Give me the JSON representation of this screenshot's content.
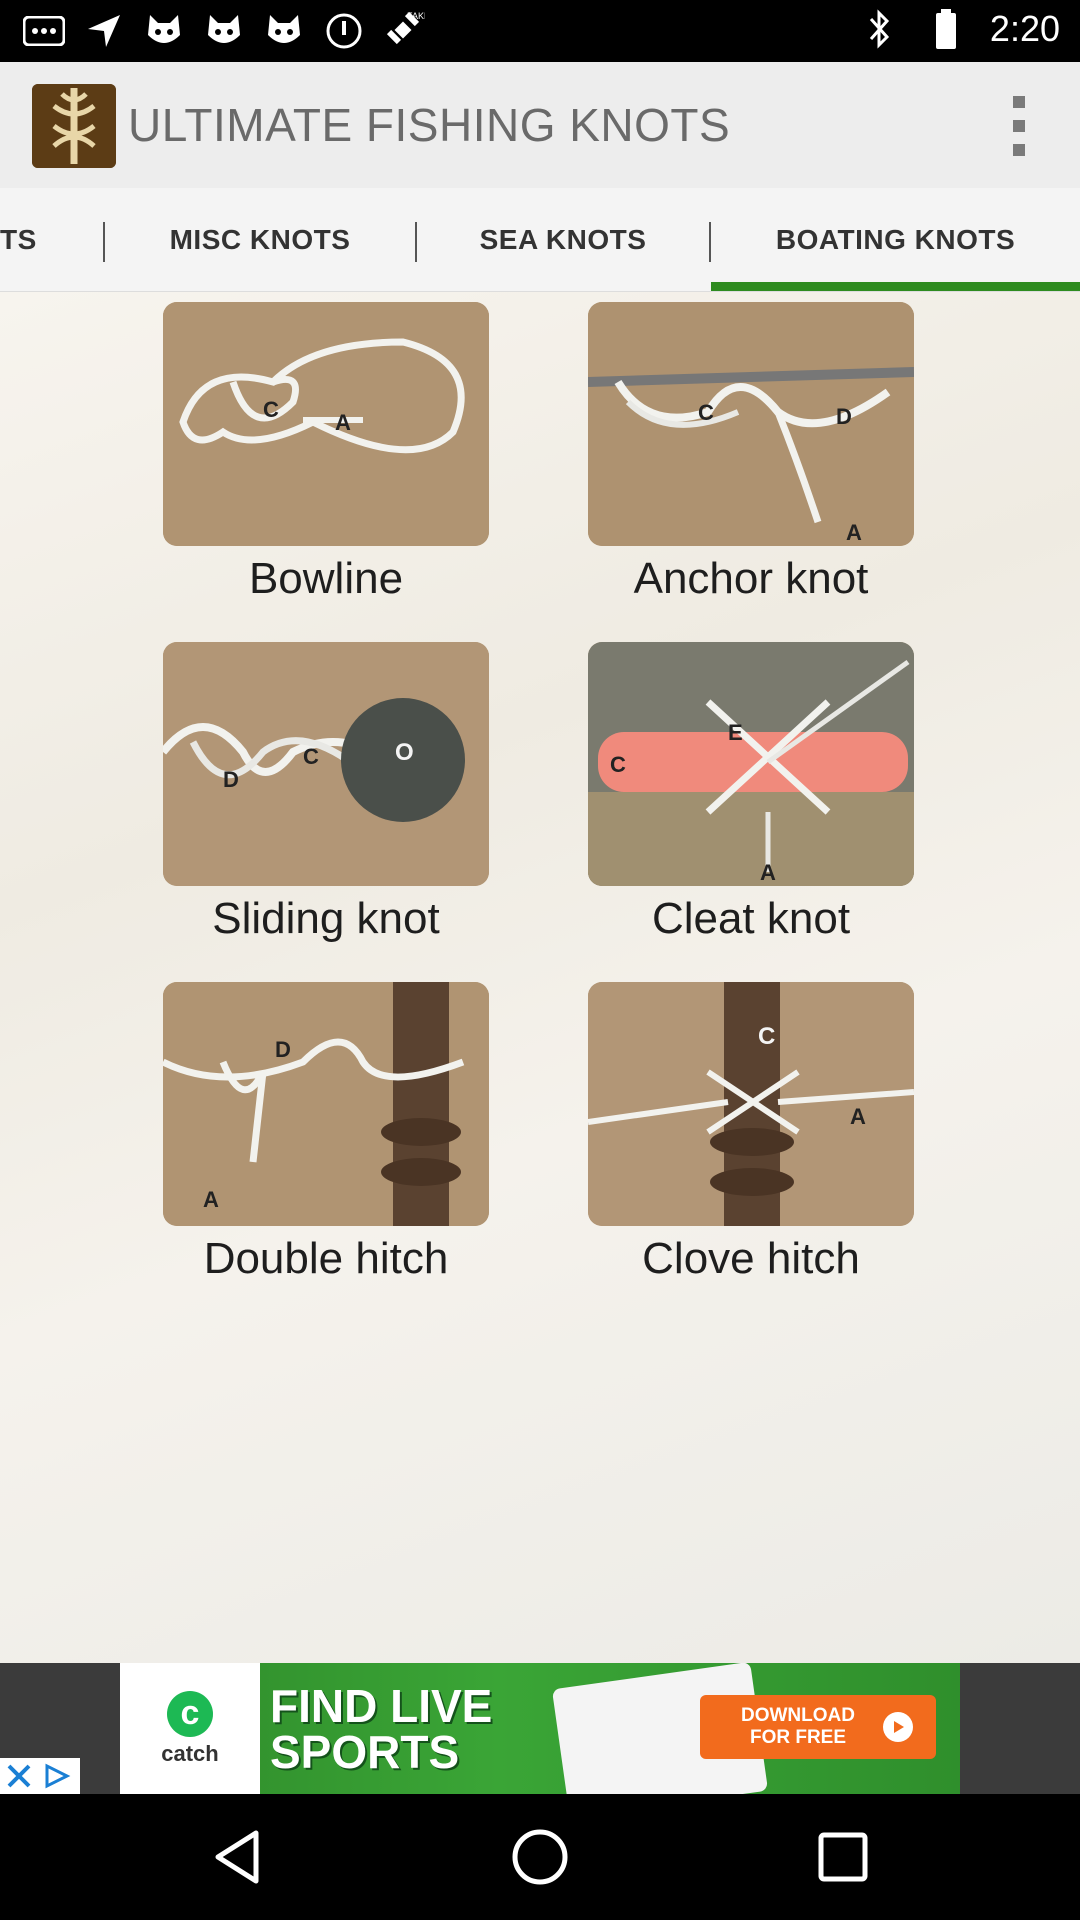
{
  "status_bar": {
    "time": "2:20",
    "icons": [
      "more-notifications-icon",
      "navigation-icon",
      "cat-icon",
      "cat-icon",
      "cat-icon",
      "sync-icon",
      "fake-gps-icon",
      "bluetooth-icon",
      "battery-icon"
    ]
  },
  "app_bar": {
    "title": "ULTIMATE FISHING KNOTS",
    "logo_icon": "knot-logo-icon",
    "menu_icon": "overflow-menu-icon"
  },
  "tabs": [
    {
      "label": "TS"
    },
    {
      "label": "MISC KNOTS"
    },
    {
      "label": "SEA KNOTS"
    },
    {
      "label": "BOATING KNOTS",
      "active": true
    }
  ],
  "accent_color": "#2e8b1f",
  "knots": [
    {
      "label": "Bowline",
      "image_letters": [
        "C",
        "A"
      ]
    },
    {
      "label": "Anchor knot",
      "image_letters": [
        "C",
        "D",
        "A"
      ]
    },
    {
      "label": "Sliding knot",
      "image_letters": [
        "D",
        "C",
        "O"
      ]
    },
    {
      "label": "Cleat knot",
      "image_letters": [
        "C",
        "E",
        "A"
      ]
    },
    {
      "label": "Double hitch",
      "image_letters": [
        "D",
        "A"
      ]
    },
    {
      "label": "Clove hitch",
      "image_letters": [
        "C",
        "A"
      ]
    }
  ],
  "ad": {
    "brand": "catch",
    "brand_sub": "SPORTS",
    "headline_line1": "FIND LIVE",
    "headline_line2": "SPORTS",
    "cta": "DOWNLOAD FOR FREE"
  },
  "nav": {
    "back_icon": "back-icon",
    "home_icon": "home-icon",
    "recents_icon": "recents-icon"
  }
}
